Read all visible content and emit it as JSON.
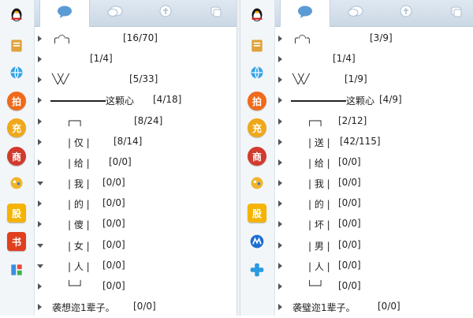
{
  "tabs": [
    {
      "name": "tab-chat",
      "icon": "chat-bubble-icon"
    },
    {
      "name": "tab-group",
      "icon": "group-chat-icon"
    },
    {
      "name": "tab-qzone",
      "icon": "qzone-icon"
    },
    {
      "name": "tab-recent",
      "icon": "recent-icon"
    }
  ],
  "sidebar_left": [
    {
      "icon": "qq-penguin-icon",
      "label": "",
      "color": "#ffffff"
    },
    {
      "icon": "notebook-icon",
      "label": "",
      "color": "#d99a2b"
    },
    {
      "icon": "browser-icon",
      "label": "",
      "color": "#1f8fd6"
    },
    {
      "icon": "auction-icon",
      "label": "拍",
      "color": "#f06a1a"
    },
    {
      "icon": "recharge-icon",
      "label": "充",
      "color": "#f0a81a"
    },
    {
      "icon": "mall-icon",
      "label": "商",
      "color": "#d13a2e"
    },
    {
      "icon": "game-icon",
      "label": "",
      "color": "#e8a21a"
    },
    {
      "icon": "stock-icon",
      "label": "股",
      "color": "#f4b400"
    },
    {
      "icon": "book-icon",
      "label": "书",
      "color": "#e0401e"
    },
    {
      "icon": "tools-icon",
      "label": "",
      "color": "#4a8fd6"
    }
  ],
  "sidebar_right": [
    {
      "icon": "qq-penguin-icon",
      "label": "",
      "color": "#ffffff"
    },
    {
      "icon": "notebook-icon",
      "label": "",
      "color": "#d99a2b"
    },
    {
      "icon": "browser-icon",
      "label": "",
      "color": "#1f8fd6"
    },
    {
      "icon": "auction-icon",
      "label": "拍",
      "color": "#f06a1a"
    },
    {
      "icon": "recharge-icon",
      "label": "充",
      "color": "#f0a81a"
    },
    {
      "icon": "mall-icon",
      "label": "商",
      "color": "#d13a2e"
    },
    {
      "icon": "game-icon",
      "label": "",
      "color": "#e8a21a"
    },
    {
      "icon": "stock-icon",
      "label": "股",
      "color": "#f4b400"
    },
    {
      "icon": "maps-icon",
      "label": "",
      "color": "#2a7ad6"
    },
    {
      "icon": "plus-icon",
      "label": "",
      "color": "#2a9ae0"
    }
  ],
  "left_groups": [
    {
      "name": "╭◠╮",
      "count": "[16/70]",
      "arrow": "right",
      "line": false
    },
    {
      "name": "",
      "count": "[1/4]",
      "arrow": "right",
      "line": false
    },
    {
      "name": "╲╳╱",
      "count": "[5/33]",
      "arrow": "right",
      "line": false
    },
    {
      "name": "这颗心",
      "count": "[4/18]",
      "arrow": "right",
      "line": true
    },
    {
      "name": "┌─┐",
      "count": "[8/24]",
      "arrow": "right",
      "line": false
    },
    {
      "name": "| 仅 |",
      "count": "[8/14]",
      "arrow": "right",
      "line": false
    },
    {
      "name": "| 给 |",
      "count": "[0/0]",
      "arrow": "right",
      "line": false
    },
    {
      "name": "| 我 |",
      "count": "[0/0]",
      "arrow": "down",
      "line": false
    },
    {
      "name": "| 的 |",
      "count": "[0/0]",
      "arrow": "right",
      "line": false
    },
    {
      "name": "| 傻 |",
      "count": "[0/0]",
      "arrow": "right",
      "line": false
    },
    {
      "name": "| 女 |",
      "count": "[0/0]",
      "arrow": "down",
      "line": false
    },
    {
      "name": "| 人 |",
      "count": "[0/0]",
      "arrow": "down",
      "line": false
    },
    {
      "name": "└─┘",
      "count": "[0/0]",
      "arrow": "right",
      "line": false
    },
    {
      "name": "袭想迩1辈子。",
      "count": "[0/0]",
      "arrow": "right",
      "line": false
    }
  ],
  "right_groups": [
    {
      "name": "╭◠╮",
      "count": "[3/9]",
      "arrow": "right",
      "line": false
    },
    {
      "name": "",
      "count": "[1/4]",
      "arrow": "right",
      "line": false
    },
    {
      "name": "╲╳╱",
      "count": "[1/9]",
      "arrow": "right",
      "line": false
    },
    {
      "name": "这颗心",
      "count": "[4/9]",
      "arrow": "right",
      "line": true
    },
    {
      "name": "┌─┐",
      "count": "[2/12]",
      "arrow": "right",
      "line": false
    },
    {
      "name": "| 送 |",
      "count": "[42/115]",
      "arrow": "right",
      "line": false
    },
    {
      "name": "| 给 |",
      "count": "[0/0]",
      "arrow": "right",
      "line": false
    },
    {
      "name": "| 我 |",
      "count": "[0/0]",
      "arrow": "right",
      "line": false
    },
    {
      "name": "| 的 |",
      "count": "[0/0]",
      "arrow": "right",
      "line": false
    },
    {
      "name": "| 坏 |",
      "count": "[0/0]",
      "arrow": "right",
      "line": false
    },
    {
      "name": "| 男 |",
      "count": "[0/0]",
      "arrow": "right",
      "line": false
    },
    {
      "name": "| 人 |",
      "count": "[0/0]",
      "arrow": "right",
      "line": false
    },
    {
      "name": "└─┘",
      "count": "[0/0]",
      "arrow": "right",
      "line": false
    },
    {
      "name": "袭璧迩1辈子。",
      "count": "[0/0]",
      "arrow": "right",
      "line": false
    }
  ]
}
